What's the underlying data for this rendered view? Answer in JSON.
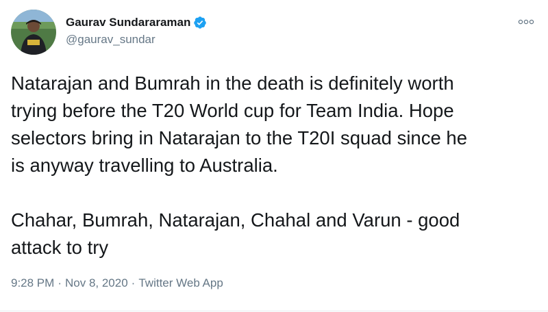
{
  "author": {
    "name": "Gaurav Sundararaman",
    "handle": "@gaurav_sundar",
    "verified_icon": "verified-badge-icon",
    "avatar_icon": "profile-photo"
  },
  "menu": {
    "more_icon": "more-options-icon",
    "more_glyph": "∘∘∘"
  },
  "tweet": {
    "paragraphs": [
      "Natarajan and Bumrah in the death is definitely worth\ntrying before the T20 World cup for Team India. Hope\nselectors bring in Natarajan to the T20I squad since he\nis anyway travelling to Australia.",
      "Chahar, Bumrah, Natarajan, Chahal and Varun - good\nattack to try"
    ]
  },
  "meta": {
    "time": "9:28 PM",
    "separator": "·",
    "date": "Nov 8, 2020",
    "source": "Twitter Web App"
  },
  "colors": {
    "verified": "#1da1f2",
    "secondary_text": "#657786",
    "primary_text": "#14171a"
  }
}
